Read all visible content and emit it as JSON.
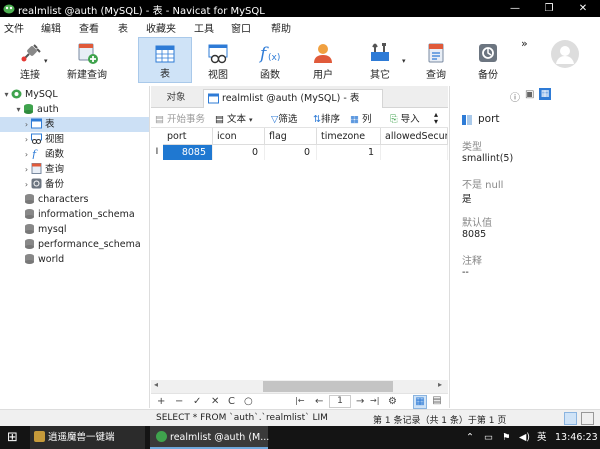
{
  "window": {
    "title": "realmlist @auth (MySQL) - 表 - Navicat for MySQL",
    "minimize": "—",
    "maximize": "❐",
    "close": "✕"
  },
  "menu": [
    "文件",
    "编辑",
    "查看",
    "表",
    "收藏夹",
    "工具",
    "窗口",
    "帮助"
  ],
  "toolbar": {
    "connect": "连接",
    "new_query": "新建查询",
    "table": "表",
    "view": "视图",
    "function": "函数",
    "user": "用户",
    "other": "其它",
    "query": "查询",
    "backup": "备份",
    "more": "»"
  },
  "tree": {
    "connection": "MySQL",
    "database": "auth",
    "items": [
      "表",
      "视图",
      "函数",
      "查询",
      "备份"
    ],
    "other_databases": [
      "characters",
      "information_schema",
      "mysql",
      "performance_schema",
      "world"
    ]
  },
  "tabs": {
    "objects": "对象",
    "active": "realmlist @auth (MySQL) - 表"
  },
  "subtoolbar": {
    "begin_transaction": "开始事务",
    "text": "文本",
    "filter": "筛选",
    "sort": "排序",
    "columns": "列",
    "import": "导入"
  },
  "grid": {
    "columns": [
      "port",
      "icon",
      "flag",
      "timezone",
      "allowedSecur"
    ],
    "row_marker": "I",
    "rows": [
      [
        "8085",
        "0",
        "0",
        "1",
        ""
      ]
    ]
  },
  "grid_toolbar": {
    "add": "+",
    "remove": "−",
    "apply": "✓",
    "discard": "✕",
    "refresh": "C",
    "stop": "○",
    "first": "|←",
    "prev": "←",
    "page": "1",
    "next": "→",
    "last": "→|",
    "settings": "⚙"
  },
  "info_panel": {
    "field_name": "port",
    "type_label": "类型",
    "type_value": "smallint(5)",
    "nullable_label": "不是 null",
    "nullable_value": "是",
    "default_label": "默认值",
    "default_value": "8085",
    "comment_label": "注释",
    "comment_value": "--"
  },
  "status": {
    "sql": "SELECT * FROM `auth`.`realmlist` LIM",
    "records": "第 1 条记录（共 1 条）于第 1 页"
  },
  "taskbar": {
    "start": "⊞",
    "app1": "逍遥魔兽一键端",
    "app2": "realmlist @auth (M...",
    "ime": "英",
    "time": "13:46:23"
  },
  "colors": {
    "accent": "#1f78d1",
    "tree_selected": "#cce0f5",
    "toolbar_active": "#cfe3f7"
  }
}
